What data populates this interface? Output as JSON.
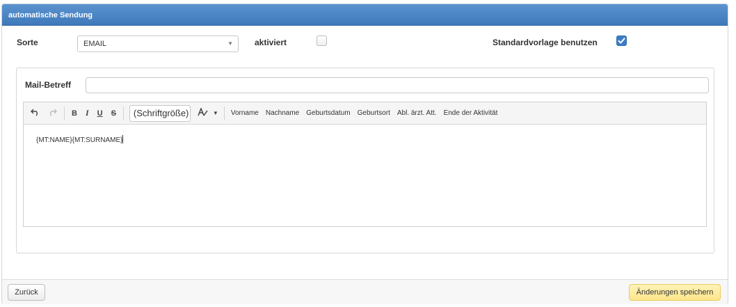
{
  "header": {
    "title": "automatische Sendung"
  },
  "form": {
    "sorte_label": "Sorte",
    "sorte_value": "EMAIL",
    "aktiviert_label": "aktiviert",
    "aktiviert_checked": false,
    "standard_label": "Standardvorlage benutzen",
    "standard_checked": true,
    "subject_label": "Mail-Betreff",
    "subject_value": ""
  },
  "toolbar": {
    "undo_icon": "undo-icon",
    "redo_icon": "redo-icon",
    "bold": "B",
    "italic": "I",
    "underline": "U",
    "strike": "S",
    "font_size_placeholder": "(Schriftgröße)",
    "placeholders": [
      "Vorname",
      "Nachname",
      "Geburtsdatum",
      "Geburtsort",
      "Abl. ärzt. Att.",
      "Ende der Aktivität"
    ]
  },
  "editor": {
    "content": "{MT:NAME}{MT:SURNAME}"
  },
  "footer": {
    "back_label": "Zurück",
    "save_label": "Änderungen speichern"
  },
  "colors": {
    "header": "#4a86c8",
    "save_button": "#fde68a",
    "checkbox_on": "#3d7cc4"
  }
}
